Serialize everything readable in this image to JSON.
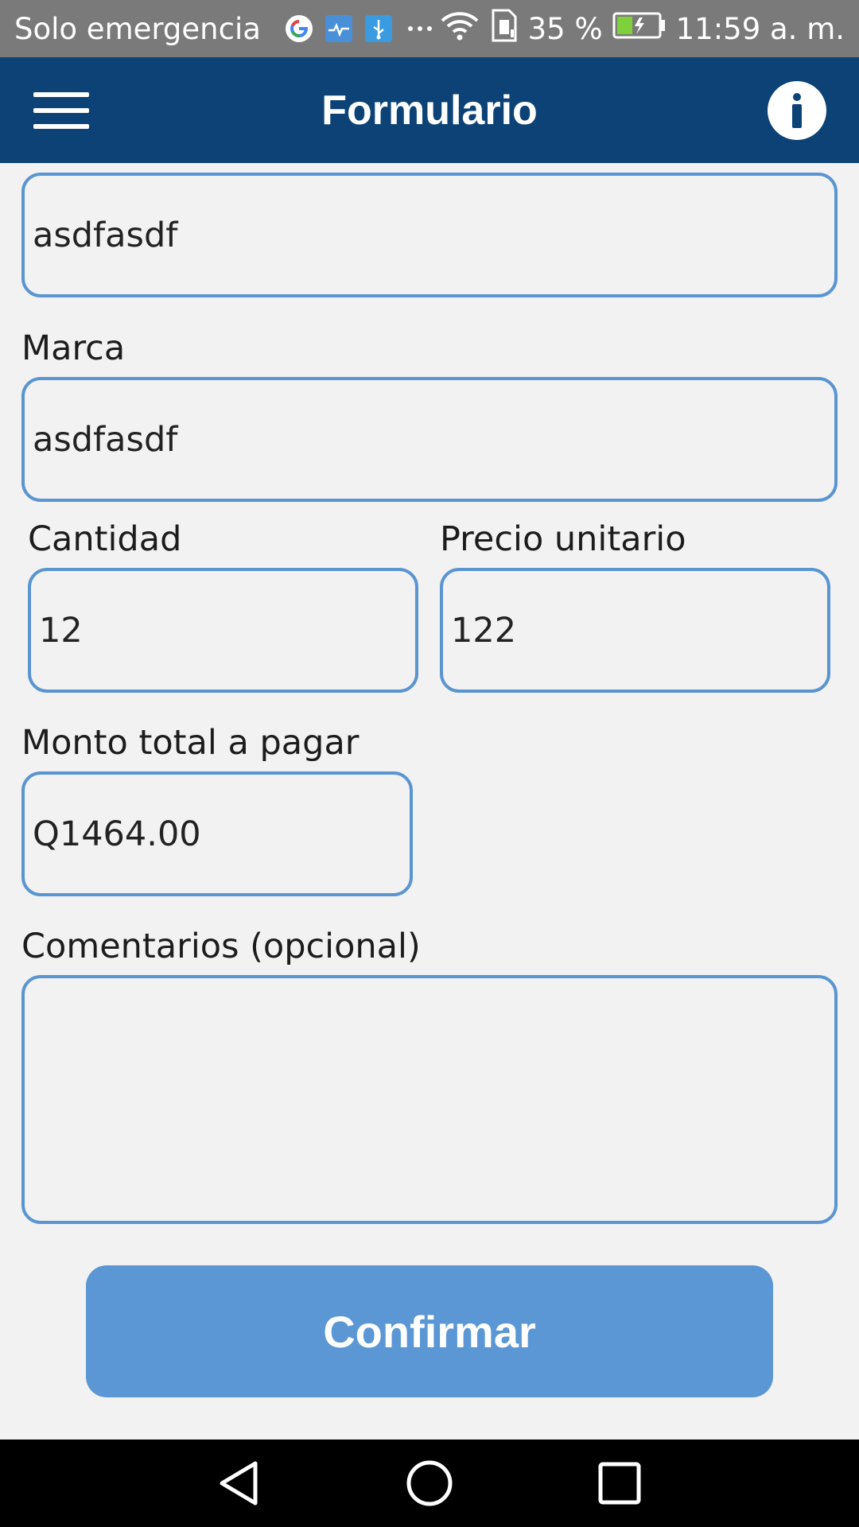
{
  "status_bar": {
    "carrier": "Solo emergencia",
    "battery_percent": "35 %",
    "time": "11:59 a. m.",
    "icons": [
      "google-icon",
      "health-icon",
      "usb-icon",
      "more-icon",
      "wifi-icon",
      "sim-icon",
      "battery-icon"
    ]
  },
  "app_bar": {
    "title": "Formulario",
    "menu_icon": "hamburger-menu-icon",
    "info_icon": "info-icon"
  },
  "form": {
    "top_field_value": "asdfasdf",
    "marca": {
      "label": "Marca",
      "value": "asdfasdf"
    },
    "cantidad": {
      "label": "Cantidad",
      "value": "12"
    },
    "precio_unitario": {
      "label": "Precio unitario",
      "value": "122"
    },
    "monto_total": {
      "label": "Monto total a pagar",
      "value": "Q1464.00"
    },
    "comentarios": {
      "label": "Comentarios (opcional)",
      "value": ""
    },
    "confirm_label": "Confirmar"
  },
  "nav_bar": {
    "icons": [
      "back-icon",
      "home-icon",
      "recents-icon"
    ]
  },
  "colors": {
    "app_bar": "#0c4276",
    "field_border": "#5a95d1",
    "button": "#5a97d4",
    "background": "#f2f2f2"
  }
}
